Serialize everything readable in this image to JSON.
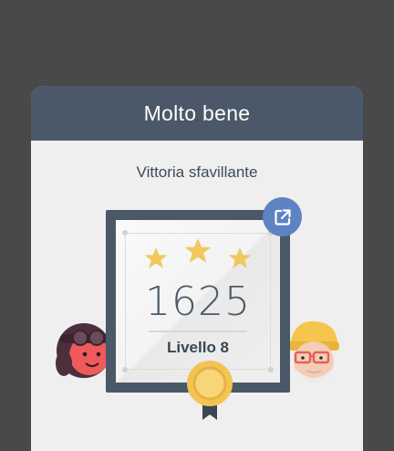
{
  "dialog": {
    "title": "Molto bene",
    "subtitle": "Vittoria sfavillante"
  },
  "award": {
    "score": "1625",
    "level_label": "Livello 8",
    "stars_earned": 3,
    "stars_total": 3
  },
  "icons": {
    "share": "share-external-icon",
    "star": "star-icon",
    "medal": "medal-icon"
  },
  "colors": {
    "background": "#494949",
    "header": "#4a5869",
    "card": "#efefef",
    "frame": "#4b5868",
    "star": "#f2c75b",
    "share_button": "#5d83c2",
    "medal": "#f3c454"
  }
}
